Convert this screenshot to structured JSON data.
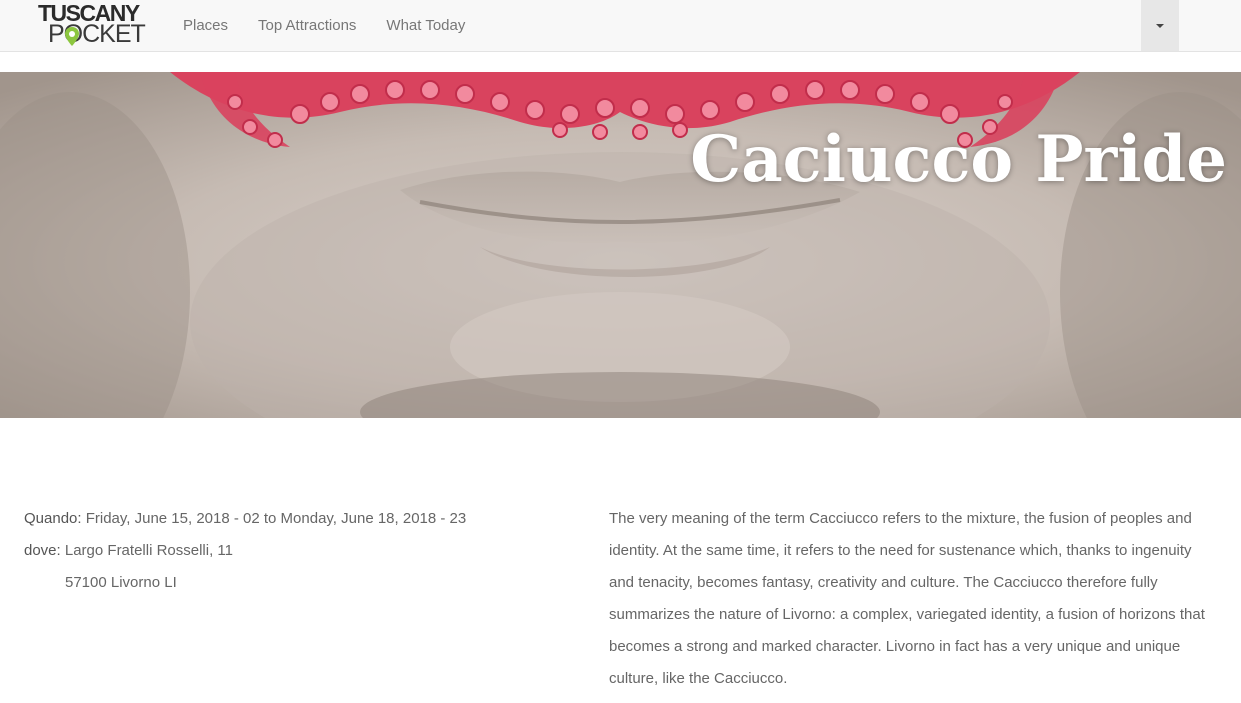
{
  "brand": {
    "line1": "TUSCANY",
    "line2": "POCKET",
    "pin_color": "#8cc63f"
  },
  "nav": {
    "items": [
      "Places",
      "Top Attractions",
      "What Today"
    ]
  },
  "hero": {
    "title": "Caciucco Pride"
  },
  "event": {
    "when_label": "Quando:",
    "when_value": " Friday, June 15, 2018 - 02 to Monday, June 18, 2018 - 23",
    "where_label": "dove:",
    "where_line1": " Largo Fratelli Rosselli, 11",
    "where_line2": "57100 Livorno LI"
  },
  "description": "The very meaning of the term Cacciucco refers to the mixture, the fusion of peoples and identity. At the same time, it refers to the need for sustenance which, thanks to ingenuity and tenacity, becomes fantasy, creativity and culture. The Cacciucco therefore fully summarizes the nature of Livorno: a complex, variegated identity, a fusion of horizons that becomes a strong and marked character. Livorno in fact has a very unique and unique culture, like the Cacciucco."
}
